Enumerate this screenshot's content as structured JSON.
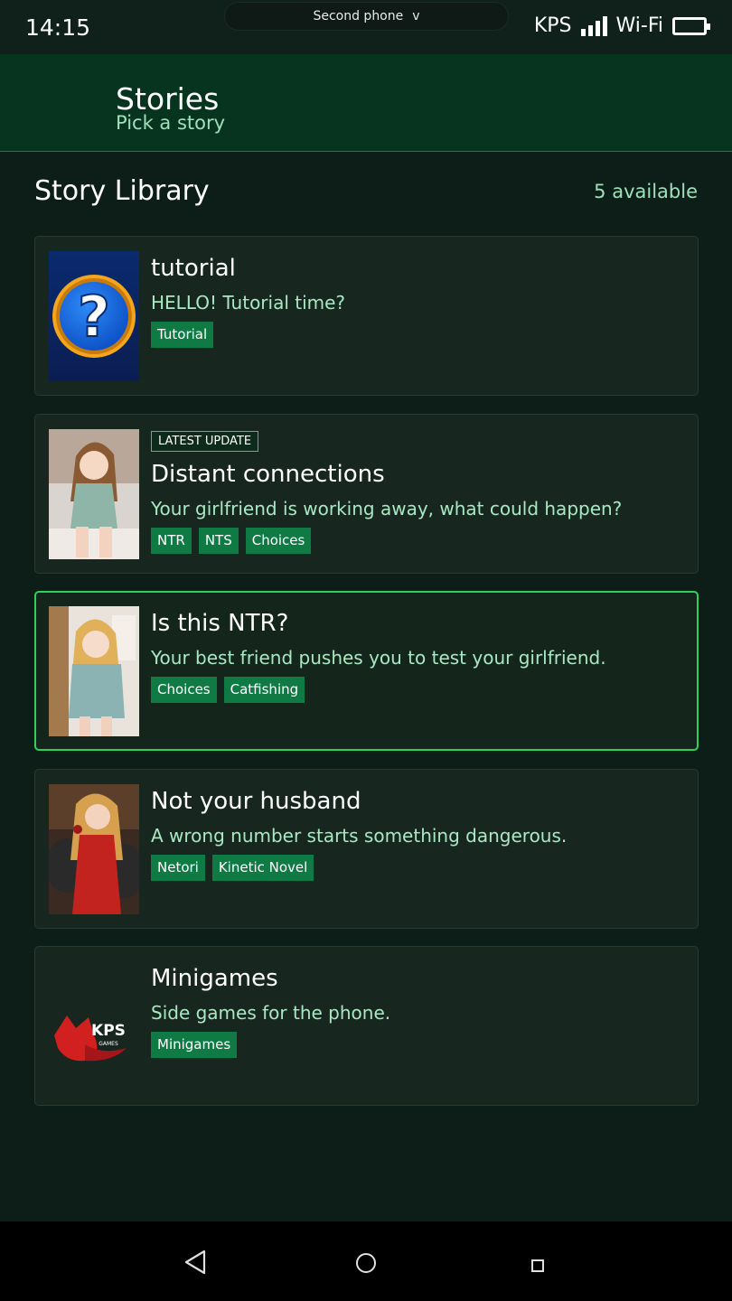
{
  "status_bar": {
    "time": "14:15",
    "device_switch_label": "Second phone",
    "device_switch_chevron": "v",
    "carrier": "KPS",
    "wifi_label": "Wi-Fi"
  },
  "app_bar": {
    "title": "Stories",
    "subtitle": "Pick a story"
  },
  "library": {
    "title": "Story Library",
    "count_label": "5 available",
    "stories": [
      {
        "thumbnail": "question-mark-icon",
        "badge": "",
        "title": "tutorial",
        "description": "HELLO! Tutorial time?",
        "tags": [
          "Tutorial"
        ]
      },
      {
        "thumbnail": "girl-sitting-on-bed-image",
        "badge": "LATEST UPDATE",
        "title": "Distant connections",
        "description": "Your girlfriend is working away, what could happen?",
        "tags": [
          "NTR",
          "NTS",
          "Choices"
        ]
      },
      {
        "thumbnail": "girl-in-hoodie-image",
        "badge": "",
        "title": "Is this NTR?",
        "description": "Your best friend pushes you to test your girlfriend.",
        "tags": [
          "Choices",
          "Catfishing"
        ],
        "selected": true
      },
      {
        "thumbnail": "woman-in-red-dress-image",
        "badge": "",
        "title": "Not your husband",
        "description": "A wrong number starts something dangerous.",
        "tags": [
          "Netori",
          "Kinetic Novel"
        ]
      },
      {
        "thumbnail": "kps-games-logo",
        "badge": "",
        "title": "Minigames",
        "description": "Side games for the phone.",
        "tags": [
          "Minigames"
        ],
        "logo_text": "KPS",
        "logo_subtext": "GAMES"
      }
    ]
  },
  "colors": {
    "accent_green": "#2fd15a",
    "tag_green": "#0f7a44",
    "app_bar_bg": "#06341f",
    "page_bg": "#0c1e17",
    "card_bg": "#17271f",
    "subtitle_green": "#9fe0bb"
  },
  "nav_bar": {
    "back_icon": "back-triangle-icon",
    "home_icon": "home-circle-icon",
    "recents_icon": "recents-square-icon"
  }
}
